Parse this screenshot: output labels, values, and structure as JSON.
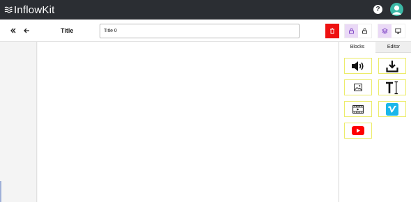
{
  "app": {
    "brand": "InflowKit",
    "help_glyph": "?"
  },
  "toolbar": {
    "title_label": "Title",
    "title_value": "Title 0",
    "icons": [
      "collapse-double-left-icon",
      "back-arrow-icon",
      "trash-icon",
      "lock-icon",
      "unlock-icon",
      "layers-icon",
      "desktop-icon"
    ],
    "delete_color": "#ee1111"
  },
  "panel": {
    "tabs": [
      {
        "label": "Blocks",
        "active": true
      },
      {
        "label": "Editor",
        "active": false
      }
    ],
    "blocks": [
      {
        "name": "audio-block",
        "icon": "speaker-icon"
      },
      {
        "name": "download-block",
        "icon": "download-icon"
      },
      {
        "name": "image-block",
        "icon": "image-icon"
      },
      {
        "name": "text-block",
        "icon": "text-cursor-icon"
      },
      {
        "name": "video-block",
        "icon": "film-icon"
      },
      {
        "name": "vimeo-block",
        "icon": "vimeo-icon"
      },
      {
        "name": "youtube-block",
        "icon": "youtube-icon"
      }
    ]
  },
  "colors": {
    "topbar": "#2b2e33",
    "accent_purple": "#7b3fc4",
    "vimeo": "#1ab7ea",
    "youtube": "#ff0000",
    "block_border": "#ecec6a",
    "avatar": "#3bb8a6"
  }
}
